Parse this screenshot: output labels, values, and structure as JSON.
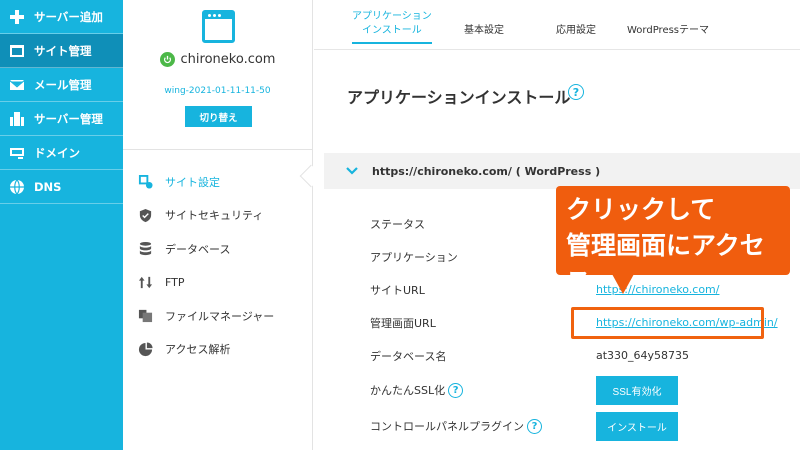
{
  "nav": {
    "items": [
      {
        "label": "サーバー追加",
        "icon": "plus-icon"
      },
      {
        "label": "サイト管理",
        "icon": "window-icon"
      },
      {
        "label": "メール管理",
        "icon": "mail-icon"
      },
      {
        "label": "サーバー管理",
        "icon": "server-building-icon"
      },
      {
        "label": "ドメイン",
        "icon": "domain-icon"
      },
      {
        "label": "DNS",
        "icon": "globe-icon"
      }
    ]
  },
  "site": {
    "domain": "chironeko.com",
    "server_name": "wing-2021-01-11-11-50",
    "switch_label": "切り替え",
    "menu": [
      {
        "label": "サイト設定",
        "icon": "site-settings-icon"
      },
      {
        "label": "サイトセキュリティ",
        "icon": "shield-icon"
      },
      {
        "label": "データベース",
        "icon": "database-icon"
      },
      {
        "label": "FTP",
        "icon": "ftp-transfer-icon"
      },
      {
        "label": "ファイルマネージャー",
        "icon": "file-manager-icon"
      },
      {
        "label": "アクセス解析",
        "icon": "analytics-icon"
      }
    ]
  },
  "tabs": [
    {
      "label_line1": "アプリケーション",
      "label_line2": "インストール"
    },
    {
      "label": "基本設定"
    },
    {
      "label": "応用設定"
    },
    {
      "label": "WordPressテーマ"
    }
  ],
  "main": {
    "title": "アプリケーションインストール",
    "help": "?",
    "section_title": "https://chironeko.com/ ( WordPress )",
    "rows": {
      "status": {
        "label": "ステータス"
      },
      "application": {
        "label": "アプリケーション"
      },
      "site_url": {
        "label": "サイトURL",
        "value": "https://chironeko.com/"
      },
      "admin_url": {
        "label": "管理画面URL",
        "value": "https://chironeko.com/wp-admin/"
      },
      "db_name": {
        "label": "データベース名",
        "value": "at330_64y58735"
      },
      "easy_ssl": {
        "label": "かんたんSSL化",
        "button": "SSL有効化"
      },
      "cp_plugin": {
        "label": "コントロールパネルプラグイン",
        "button": "インストール"
      }
    }
  },
  "callout": {
    "line1": "クリックして",
    "line2": "管理画面にアクセス"
  },
  "colors": {
    "accent": "#17b4de",
    "nav_active": "#0f8fb8",
    "callout": "#f05d0e",
    "power": "#4cb848"
  }
}
